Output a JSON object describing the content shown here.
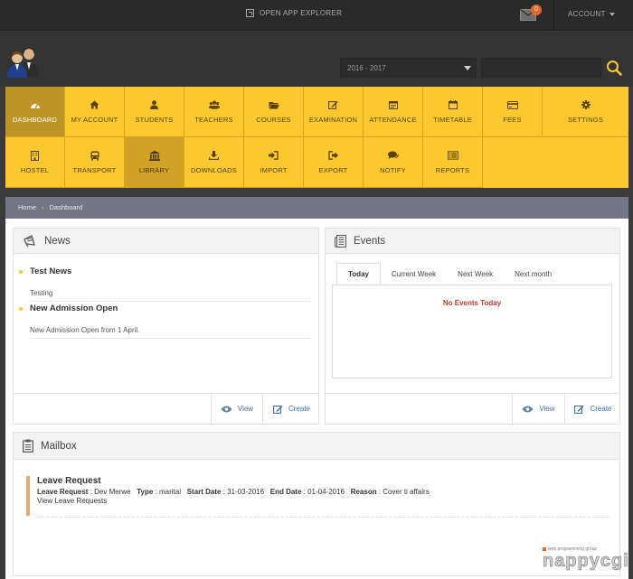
{
  "topbar": {
    "app_explorer": "OPEN APP EXPLORER",
    "mail_count": "0",
    "account": "ACCOUNT"
  },
  "header": {
    "year": "2016 - 2017",
    "search_placeholder": ""
  },
  "nav": {
    "row1": [
      {
        "label": "DASHBOARD",
        "icon": "dashboard-icon"
      },
      {
        "label": "MY ACCOUNT",
        "icon": "home-icon"
      },
      {
        "label": "STUDENTS",
        "icon": "user-icon"
      },
      {
        "label": "TEACHERS",
        "icon": "users-icon"
      },
      {
        "label": "COURSES",
        "icon": "folder-icon"
      },
      {
        "label": "EXAMINATION",
        "icon": "edit-icon"
      },
      {
        "label": "ATTENDANCE",
        "icon": "calendar-icon"
      },
      {
        "label": "TIMETABLE",
        "icon": "calendar-icon"
      },
      {
        "label": "FEES",
        "icon": "credit-card-icon"
      },
      {
        "label": "SETTINGS",
        "icon": "gear-icon"
      }
    ],
    "row2": [
      {
        "label": "HOSTEL",
        "icon": "building-icon"
      },
      {
        "label": "TRANSPORT",
        "icon": "bus-icon"
      },
      {
        "label": "LIBRARY",
        "icon": "bank-icon"
      },
      {
        "label": "DOWNLOADS",
        "icon": "download-icon"
      },
      {
        "label": "IMPORT",
        "icon": "sign-in-icon"
      },
      {
        "label": "EXPORT",
        "icon": "sign-out-icon"
      },
      {
        "label": "NOTIFY",
        "icon": "comments-icon"
      },
      {
        "label": "REPORTS",
        "icon": "list-alt-icon"
      }
    ]
  },
  "breadcrumb": {
    "home": "Home",
    "current": "Dashboard"
  },
  "news": {
    "title": "News",
    "items": [
      {
        "title": "Test News",
        "desc": "Testing"
      },
      {
        "title": "New Admission Open",
        "desc": "New Admission Open from 1 April."
      }
    ],
    "view": "View",
    "create": "Create"
  },
  "events": {
    "title": "Events",
    "tabs": [
      "Today",
      "Current Week",
      "Next Week",
      "Next month"
    ],
    "empty": "No Events Today",
    "view": "View",
    "create": "Create"
  },
  "mailbox": {
    "title": "Mailbox",
    "entry": {
      "title": "Leave Request",
      "leave_request_label": "Leave Request",
      "leave_request_value": " : Dev Merwe",
      "type_label": "Type",
      "type_value": " : marital",
      "start_label": "Start Date",
      "start_value": " : 31-03-2016",
      "end_label": "End Date",
      "end_value": " : 01-04-2016",
      "reason_label": "Reason",
      "reason_value": " : Cover ti affairs",
      "link": "View Leave Requests"
    }
  },
  "watermark": {
    "small": "web programming group",
    "big": "nappycgi"
  }
}
